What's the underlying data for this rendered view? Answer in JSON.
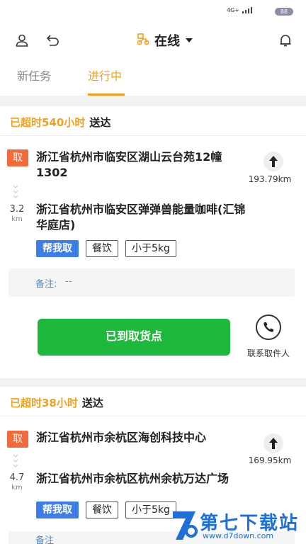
{
  "status_bar": {
    "network": "4G+",
    "battery": "88"
  },
  "header": {
    "status": "在线"
  },
  "tabs": [
    {
      "label": "新任务",
      "active": false
    },
    {
      "label": "进行中",
      "active": true
    }
  ],
  "orders": [
    {
      "overtime": "已超时540小时",
      "deliver": "送达",
      "pickup_tag": "取",
      "pickup_address": "浙江省杭州市临安区湖山云台苑12幢1302",
      "distance": "193.79km",
      "gap_value": "3.2",
      "gap_unit": "km",
      "delivery_address": "浙江省杭州市临安区弹弹兽能量咖啡(汇锦华庭店)",
      "tags": [
        "帮我取",
        "餐饮",
        "小于5kg"
      ],
      "remark_label": "备注:",
      "remark_value": "--",
      "action_button": "已到取货点",
      "contact_label": "联系取件人"
    },
    {
      "overtime": "已超时38小时",
      "deliver": "送达",
      "pickup_tag": "取",
      "pickup_address": "浙江省杭州市余杭区海创科技中心",
      "distance": "169.95km",
      "gap_value": "4.7",
      "gap_unit": "km",
      "delivery_address": "浙江省杭州市余杭区杭州余杭万达广场",
      "tags": [
        "帮我取",
        "餐饮",
        "小于5kg"
      ],
      "remark_label": "备注"
    }
  ],
  "watermark": {
    "title": "第七下载站",
    "url": "www.d7down.com"
  },
  "colors": {
    "accent": "#f0a020",
    "primary_button": "#1db83c",
    "pickup_tag": "#f06a3a",
    "tag_blue": "#3d7de8"
  }
}
